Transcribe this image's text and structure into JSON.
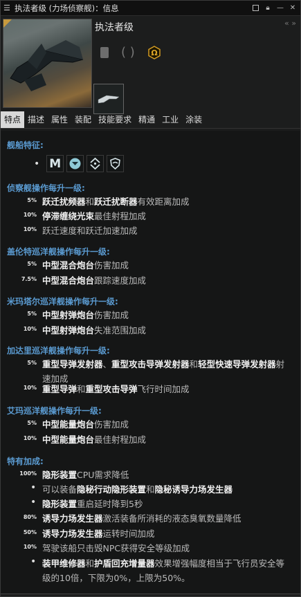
{
  "window": {
    "title": "执法者级 (力场侦察舰)：信息"
  },
  "ship": {
    "name": "执法者级"
  },
  "tabs": [
    "特点",
    "描述",
    "属性",
    "装配",
    "技能要求",
    "精通",
    "工业",
    "涂装"
  ],
  "traits": {
    "header": "舰船特征:",
    "role_icons": [
      "m-icon",
      "down-chevron-icon",
      "target-icon",
      "shield-icon"
    ],
    "sections": [
      {
        "title": "侦察舰操作每升一级:",
        "items": [
          {
            "pct": "5%",
            "parts": [
              [
                "b",
                "跃迁扰频器"
              ],
              [
                "t",
                "和"
              ],
              [
                "b",
                "跃迁扰断器"
              ],
              [
                "t",
                "有效距离加成"
              ]
            ]
          },
          {
            "pct": "10%",
            "parts": [
              [
                "b",
                "停滞缠绕光束"
              ],
              [
                "t",
                "最佳射程加成"
              ]
            ]
          },
          {
            "pct": "10%",
            "parts": [
              [
                "t",
                "跃迁速度和跃迁加速加成"
              ]
            ]
          }
        ]
      },
      {
        "title": "盖伦特巡洋舰操作每升一级:",
        "items": [
          {
            "pct": "5%",
            "parts": [
              [
                "b",
                "中型混合炮台"
              ],
              [
                "t",
                "伤害加成"
              ]
            ]
          },
          {
            "pct": "7.5%",
            "parts": [
              [
                "b",
                "中型混合炮台"
              ],
              [
                "t",
                "跟踪速度加成"
              ]
            ]
          }
        ]
      },
      {
        "title": "米玛塔尔巡洋舰操作每升一级:",
        "items": [
          {
            "pct": "5%",
            "parts": [
              [
                "b",
                "中型射弹炮台"
              ],
              [
                "t",
                "伤害加成"
              ]
            ]
          },
          {
            "pct": "10%",
            "parts": [
              [
                "b",
                "中型射弹炮台"
              ],
              [
                "t",
                "失准范围加成"
              ]
            ]
          }
        ]
      },
      {
        "title": "加达里巡洋舰操作每升一级:",
        "items": [
          {
            "pct": "5%",
            "parts": [
              [
                "b",
                "重型导弹发射器"
              ],
              [
                "t",
                "、"
              ],
              [
                "b",
                "重型攻击导弹发射器"
              ],
              [
                "t",
                "和"
              ],
              [
                "b",
                "轻型快速导弹发射器"
              ],
              [
                "t",
                "射速加成"
              ]
            ]
          },
          {
            "pct": "10%",
            "parts": [
              [
                "b",
                "重型导弹"
              ],
              [
                "t",
                "和"
              ],
              [
                "b",
                "重型攻击导弹"
              ],
              [
                "t",
                "飞行时间加成"
              ]
            ]
          }
        ]
      },
      {
        "title": "艾玛巡洋舰操作每升一级:",
        "items": [
          {
            "pct": "5%",
            "parts": [
              [
                "b",
                "中型能量炮台"
              ],
              [
                "t",
                "伤害加成"
              ]
            ]
          },
          {
            "pct": "10%",
            "parts": [
              [
                "b",
                "中型能量炮台"
              ],
              [
                "t",
                "最佳射程加成"
              ]
            ]
          }
        ]
      },
      {
        "title": "特有加成:",
        "items": [
          {
            "pct": "100%",
            "parts": [
              [
                "b",
                "隐形装置"
              ],
              [
                "t",
                "CPU需求降低"
              ]
            ]
          },
          {
            "bullet": true,
            "parts": [
              [
                "t",
                "可以装备"
              ],
              [
                "b",
                "隐秘行动隐形装置"
              ],
              [
                "t",
                "和"
              ],
              [
                "b",
                "隐秘诱导力场发生器"
              ]
            ]
          },
          {
            "bullet": true,
            "parts": [
              [
                "b",
                "隐形装置"
              ],
              [
                "t",
                "重启延时降到5秒"
              ]
            ]
          },
          {
            "pct": "80%",
            "parts": [
              [
                "b",
                "诱导力场发生器"
              ],
              [
                "t",
                "激活装备所消耗的液态臭氧数量降低"
              ]
            ]
          },
          {
            "pct": "50%",
            "parts": [
              [
                "b",
                "诱导力场发生器"
              ],
              [
                "t",
                "运转时间加成"
              ]
            ]
          },
          {
            "pct": "10%",
            "parts": [
              [
                "t",
                "驾驶该船只击毁NPC获得安全等级加成"
              ]
            ]
          },
          {
            "bullet": true,
            "parts": [
              [
                "b",
                "装甲维修器"
              ],
              [
                "t",
                "和"
              ],
              [
                "b",
                "护盾回充增量器"
              ],
              [
                "t",
                "效果增强幅度相当于飞行员安全等级的10倍，下限为0%，上限为50%。"
              ]
            ]
          }
        ]
      }
    ]
  }
}
